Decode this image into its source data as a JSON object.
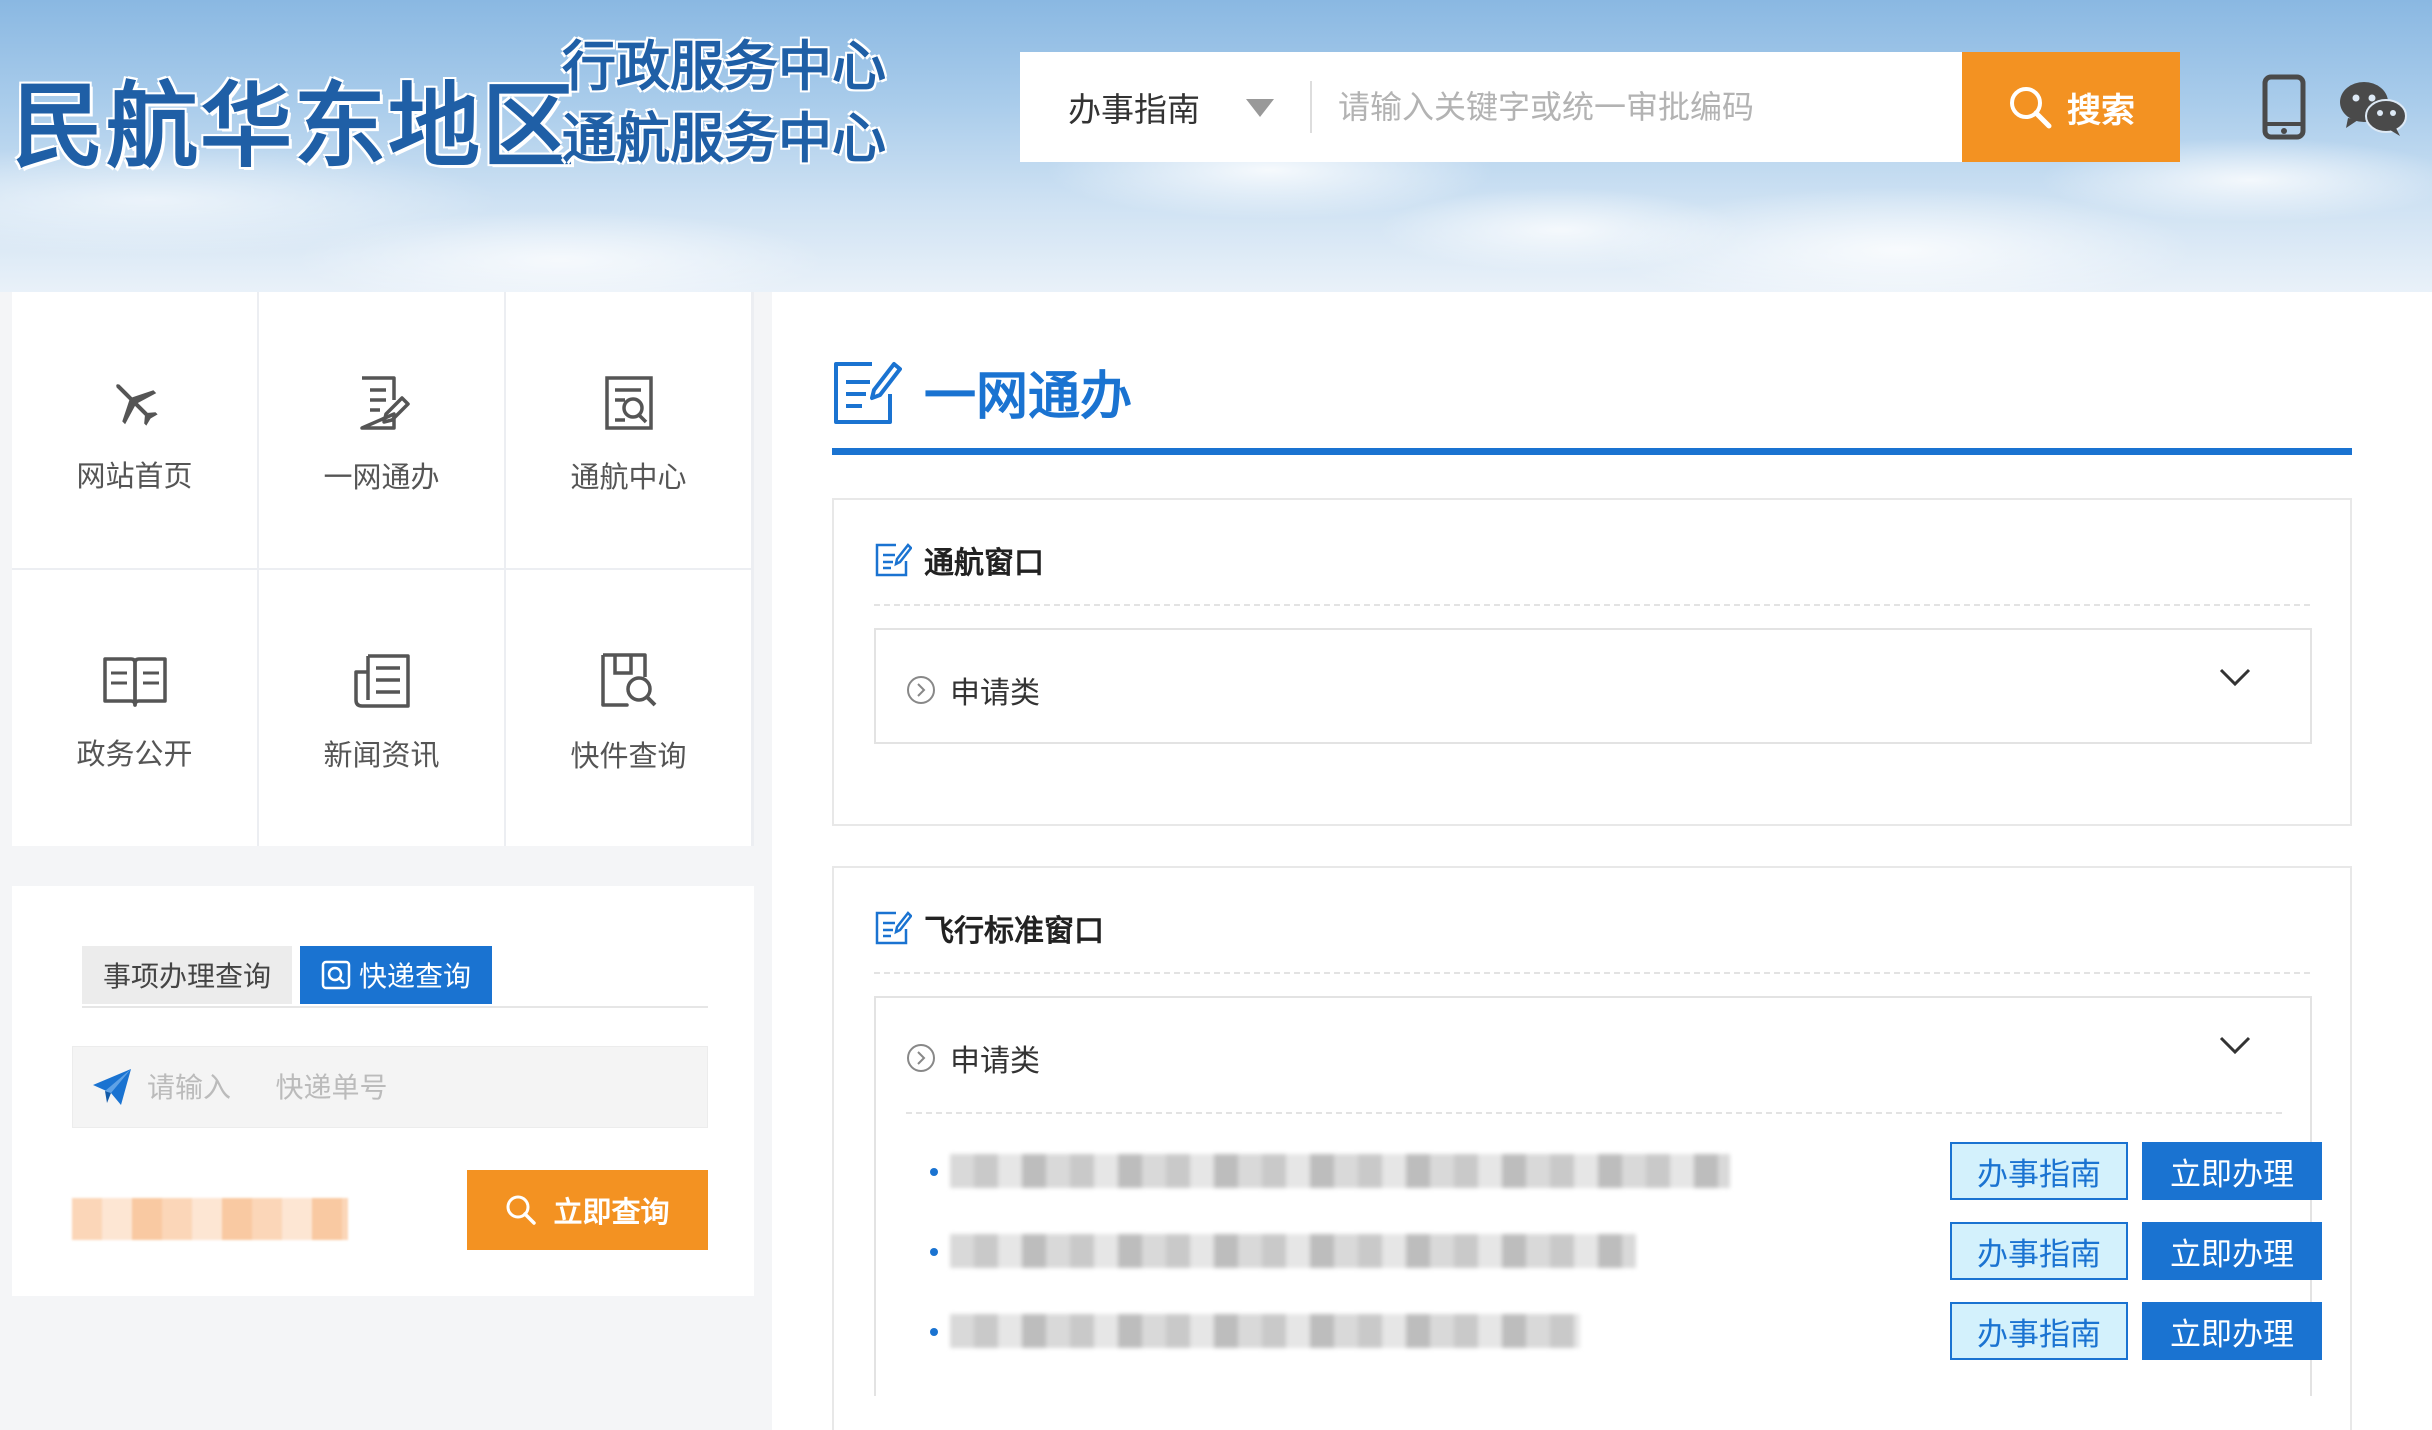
{
  "header": {
    "logo_main": "民航华东地区",
    "logo_sub_line1": "行政服务中心",
    "logo_sub_line2": "通航服务中心",
    "search": {
      "category_selected": "办事指南",
      "placeholder": "请输入关键字或统一审批编码",
      "button_label": "搜索"
    },
    "icons": [
      "mobile-phone-icon",
      "wechat-icon"
    ]
  },
  "nav": {
    "items": [
      {
        "label": "网站首页",
        "icon": "airplane-icon"
      },
      {
        "label": "一网通办",
        "icon": "document-edit-icon"
      },
      {
        "label": "通航中心",
        "icon": "document-search-icon"
      },
      {
        "label": "政务公开",
        "icon": "open-book-icon"
      },
      {
        "label": "新闻资讯",
        "icon": "news-icon"
      },
      {
        "label": "快件查询",
        "icon": "package-search-icon"
      }
    ]
  },
  "query": {
    "tabs": [
      {
        "label": "事项办理查询",
        "active": false
      },
      {
        "label": "快递查询",
        "active": true
      }
    ],
    "input_placeholder": "请输入     快递单号",
    "submit_label": "立即查询"
  },
  "main": {
    "title": "一网通办",
    "sections": [
      {
        "title": "通航窗口",
        "accordion": {
          "label": "申请类",
          "expanded": false,
          "items": []
        }
      },
      {
        "title": "飞行标准窗口",
        "accordion": {
          "label": "申请类",
          "expanded": true,
          "items": [
            {
              "guide_label": "办事指南",
              "do_label": "立即办理"
            },
            {
              "guide_label": "办事指南",
              "do_label": "立即办理"
            },
            {
              "guide_label": "办事指南",
              "do_label": "立即办理"
            }
          ]
        }
      }
    ]
  },
  "colors": {
    "primary_blue": "#1a73d1",
    "accent_orange": "#f39222",
    "guide_button_bg": "#d3f1fc"
  }
}
